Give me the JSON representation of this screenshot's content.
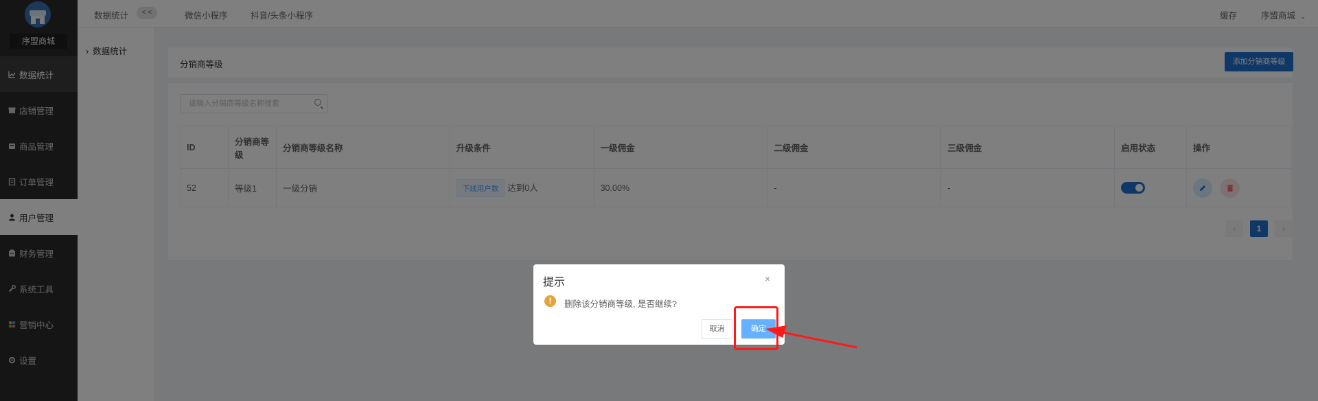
{
  "sidebar": {
    "shop_name": "序盟商城",
    "items": [
      {
        "label": "数据统计",
        "icon": "chart-line-icon"
      },
      {
        "label": "店铺管理",
        "icon": "shop-icon"
      },
      {
        "label": "商品管理",
        "icon": "goods-icon"
      },
      {
        "label": "订单管理",
        "icon": "order-icon"
      },
      {
        "label": "用户管理",
        "icon": "user-icon"
      },
      {
        "label": "财务管理",
        "icon": "finance-icon"
      },
      {
        "label": "系统工具",
        "icon": "wrench-icon"
      },
      {
        "label": "营销中心",
        "icon": "marketing-icon"
      },
      {
        "label": "设置",
        "icon": "gear-icon"
      }
    ]
  },
  "topbar": {
    "section_title": "数据统计",
    "collapse_label": "< <",
    "links": [
      "微信小程序",
      "抖音/头条小程序"
    ],
    "cache_label": "缓存",
    "user_label": "序盟商城"
  },
  "subnav": {
    "item": "数据统计"
  },
  "page": {
    "title": "分销商等级",
    "add_button": "添加分销商等级",
    "search_placeholder": "请输入分销商等级名称搜索"
  },
  "table": {
    "headers": [
      "ID",
      "分销商等级",
      "分销商等级名称",
      "升级条件",
      "一级佣金",
      "二级佣金",
      "三级佣金",
      "启用状态",
      "操作"
    ],
    "rows": [
      {
        "id": "52",
        "level": "等级1",
        "name": "一级分销",
        "condition_tag": "下线用户数",
        "condition_text": "达到0人",
        "commission1": "30.00%",
        "commission2": "-",
        "commission3": "-",
        "enabled": true
      }
    ]
  },
  "pagination": {
    "prev": "‹",
    "current": "1",
    "next": "›"
  },
  "dialog": {
    "title": "提示",
    "close": "×",
    "icon": "!",
    "message": "删除该分销商等级, 是否继续?",
    "cancel": "取消",
    "confirm": "确定"
  },
  "colors": {
    "primary": "#1f6fd1",
    "confirm": "#66b1ff",
    "warning": "#e6a23c",
    "annotation": "#ff1a1a"
  }
}
